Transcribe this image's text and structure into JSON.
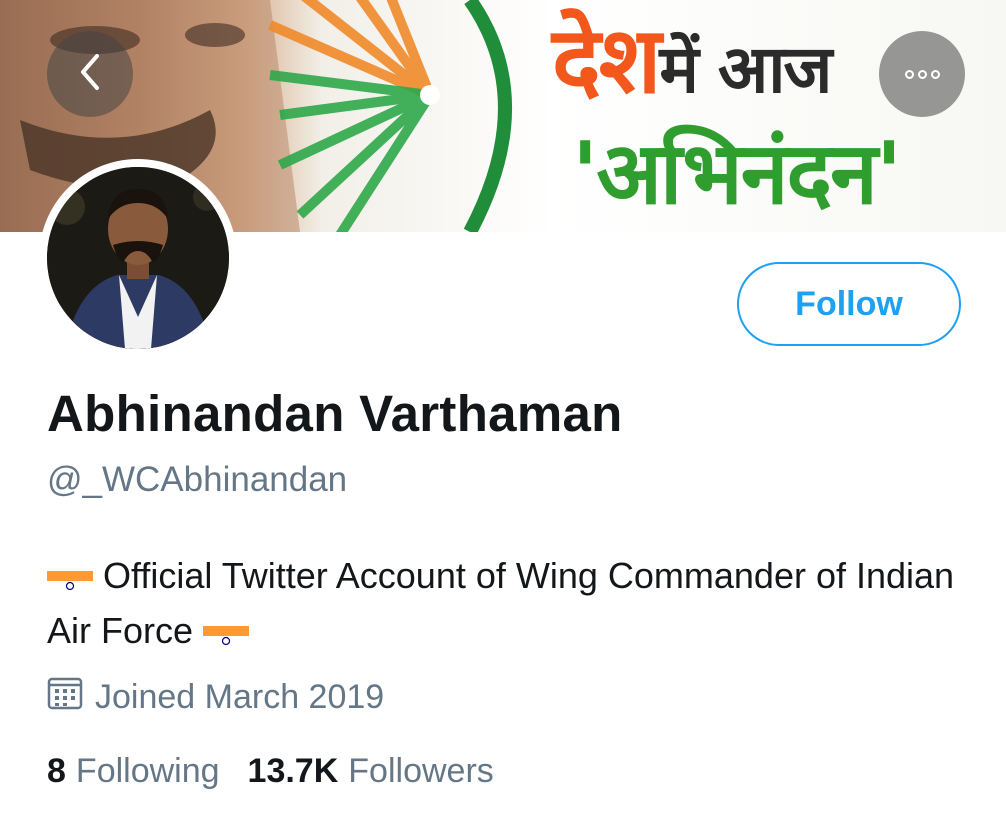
{
  "banner": {
    "text_line1_orange": "देश",
    "text_line1_dark": "में आज",
    "text_line2": "'अभिनंदन'"
  },
  "header": {
    "back_icon": "chevron-left-icon",
    "more_icon": "more-options-icon"
  },
  "profile": {
    "follow_label": "Follow",
    "display_name": "Abhinandan Varthaman",
    "handle": "@_WCAbhinandan",
    "bio_text": "Official Twitter Account of Wing Commander of Indian Air Force",
    "bio_emoji": "flag-india",
    "joined": "Joined March 2019",
    "following_count": "8",
    "following_label": "Following",
    "followers_count": "13.7K",
    "followers_label": "Followers"
  },
  "colors": {
    "accent": "#1da1f2",
    "secondary_text": "#657786",
    "primary_text": "#14171a"
  }
}
